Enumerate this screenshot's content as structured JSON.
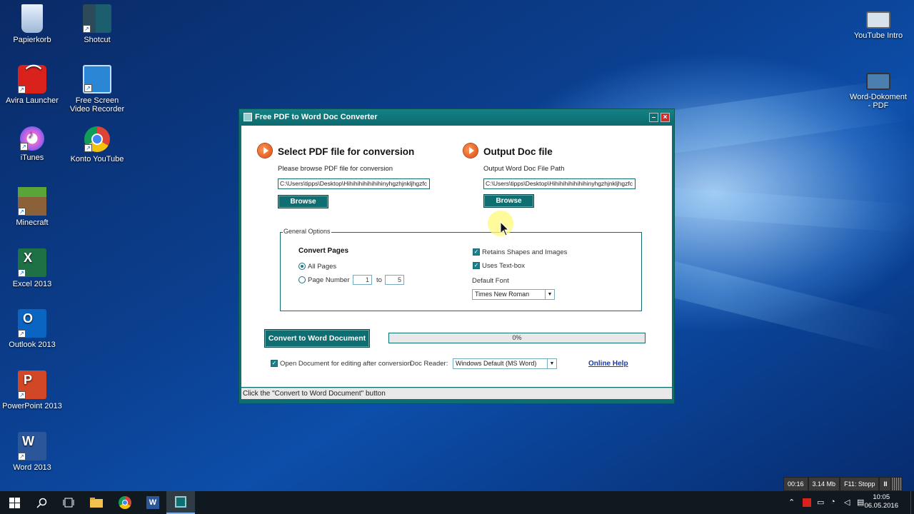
{
  "desktop": {
    "icons_left": [
      {
        "label": "Papierkorb",
        "icon": "recycle-bin-icon"
      },
      {
        "label": "Shotcut",
        "icon": "shotcut-icon"
      },
      {
        "label": "Avira Launcher",
        "icon": "avira-icon"
      },
      {
        "label": "Free Screen Video Recorder",
        "icon": "screen-recorder-icon"
      },
      {
        "label": "iTunes",
        "icon": "itunes-icon"
      },
      {
        "label": "Konto YouTube",
        "icon": "chrome-icon"
      },
      {
        "label": "Minecraft",
        "icon": "minecraft-icon"
      },
      {
        "label": "Excel 2013",
        "icon": "excel-icon"
      },
      {
        "label": "Outlook 2013",
        "icon": "outlook-icon"
      },
      {
        "label": "PowerPoint 2013",
        "icon": "powerpoint-icon"
      },
      {
        "label": "Word 2013",
        "icon": "word-icon"
      }
    ],
    "icons_right": [
      {
        "label": "YouTube Intro",
        "icon": "video-file-icon"
      },
      {
        "label": "Word-Dokoment - PDF",
        "icon": "video-file-icon"
      }
    ]
  },
  "window": {
    "title": "Free PDF to Word Doc Converter",
    "minimize": "–",
    "close": "×",
    "input_section": {
      "heading": "Select PDF file for conversion",
      "subtitle": "Please browse PDF file for conversion",
      "path": "C:\\Users\\tipps\\Desktop\\Hihihihihihihihinyhgzhjnkljhgzfc",
      "browse": "Browse"
    },
    "output_section": {
      "heading": "Output Doc file",
      "subtitle": "Output Word Doc File Path",
      "path": "C:\\Users\\tipps\\Desktop\\Hihihihihihihihinyhgzhjnkljhgzfc",
      "browse": "Browse"
    },
    "general_options": {
      "legend": "General Options",
      "convert_pages_label": "Convert Pages",
      "all_pages": "All Pages",
      "page_number": "Page Number",
      "from": "1",
      "to_label": "to",
      "to": "5",
      "retains_shapes": "Retains Shapes and Images",
      "uses_textbox": "Uses Text-box",
      "default_font_label": "Default Font",
      "default_font": "Times New Roman"
    },
    "convert_button": "Convert to Word Document",
    "progress": "0%",
    "progress_value": 0,
    "open_after": "Open Document for editing after conversion",
    "doc_reader_label": "Doc Reader:",
    "doc_reader": "Windows Default (MS Word)",
    "online_help": "Online Help",
    "status": "Click the \"Convert to Word Document\" button"
  },
  "recorder": {
    "time": "00:16",
    "size": "3.14 Mb",
    "stop": "F11: Stopp",
    "pause": "II"
  },
  "taskbar": {
    "time": "10:05",
    "date": "06.05.2016"
  },
  "colors": {
    "accent": "#0e6f73",
    "orange": "#e2541a"
  }
}
